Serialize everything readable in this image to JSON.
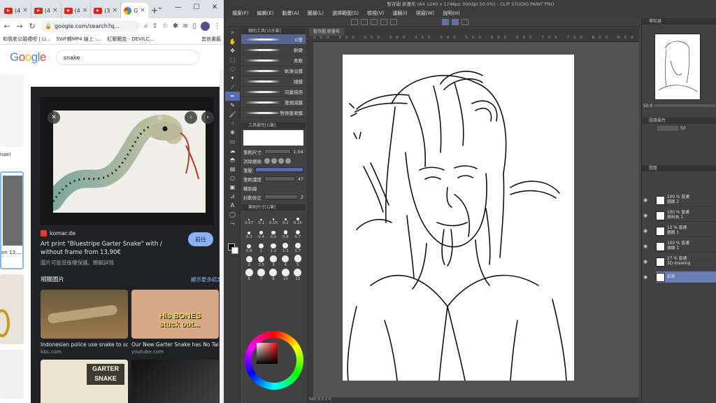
{
  "chrome": {
    "tabs": [
      {
        "label": "(4",
        "icon": "youtube-icon"
      },
      {
        "label": "(4",
        "icon": "youtube-icon"
      },
      {
        "label": "(4",
        "icon": "youtube-icon"
      },
      {
        "label": "(3",
        "icon": "youtube-icon"
      },
      {
        "label": "G",
        "icon": "google-icon",
        "active": true
      }
    ],
    "new_tab": "+",
    "url": "google.com/search?q...",
    "bookmarks": [
      "和我老公婚禮吧 | LI...",
      "SWF轉MP4 線上 -...",
      "紅爾爾克 - DEVILC...",
      "其他書籤"
    ],
    "google_logo": "Google",
    "query": "snake",
    "left_snippets": [
      "nae)",
      "on 13,..."
    ],
    "panel": {
      "source": "komar.de",
      "title": "Art print \"Bluestripe Garter Snake\" with / without frame from 13,90€",
      "visit": "前往",
      "copyright": "圖片可能受版權保護。瞭解詳情",
      "related_heading": "相關圖片",
      "related_more": "顯示更多結果",
      "related": [
        {
          "title": "Indonesian police use snake to scar...",
          "site": "bbc.com"
        },
        {
          "title": "Our New Garter Snake has No Tail! -...",
          "site": "youtube.com",
          "overlay": "His BONES stuck out..."
        },
        {
          "title": "",
          "site": "",
          "overlay": "GARTER SNAKE"
        },
        {
          "title": "",
          "site": ""
        }
      ]
    }
  },
  "csp": {
    "title": "暫存圖 新畫布 (A4 1240 x 1748px 300dpi 50.0%) - CLIP STUDIO PAINT PRO",
    "menu": [
      "檔案(F)",
      "編輯(E)",
      "動畫(A)",
      "圖層(L)",
      "選擇範圍(S)",
      "檢視(V)",
      "濾鏡(I)",
      "視窗(W)",
      "說明(H)"
    ],
    "doc_tabs": [
      "暫存圖 新畫布"
    ],
    "ruler": "250 300 350 400 450 500 550 600 650 700 750 800 850 900 950 1000 1050 1100",
    "sub_tool_title": "輔助工具[沾水筆]",
    "brushes": [
      "G筆",
      "軟硬",
      "柔軟",
      "軟漸淡膜",
      "細膜",
      "向量描用",
      "筆頭減膜",
      "對齊筆漸膜"
    ],
    "tool_prop_title": "工具屬性[G筆]",
    "props": [
      {
        "label": "筆刷尺寸",
        "value": "1.04"
      },
      {
        "label": "消除鋸齒",
        "value": ""
      },
      {
        "label": "筆壓",
        "value": ""
      },
      {
        "label": "筆刷濃度",
        "value": "47"
      },
      {
        "label": "輔助線",
        "value": ""
      },
      {
        "label": "抖動修正",
        "value": "2"
      }
    ],
    "size_title": "筆刷尺寸[G筆]",
    "sizes": [
      "0.07",
      "0.1",
      "0.15",
      "0.2",
      "0.25",
      "0.3",
      "0.4",
      "0.5",
      "0.6",
      "0.7",
      "0.8",
      "1",
      "1.2",
      "1.5",
      "1.7",
      "2",
      "2.5",
      "3",
      "4",
      "5",
      "6",
      "7",
      "8",
      "10",
      "12"
    ],
    "nav_title": "導航器",
    "nav_zoom": "50.0",
    "layer_prop_title": "圖層屬性",
    "layer_blend": "50",
    "layer_title": "圖層",
    "layers": [
      {
        "name": "100 % 普通\n圖層 2",
        "sel": false
      },
      {
        "name": "100 % 普通\n資料夾 1",
        "sel": false
      },
      {
        "name": "13 % 普通\n圖層 1",
        "sel": false
      },
      {
        "name": "100 % 普通\n描線 1",
        "sel": false
      },
      {
        "name": "27 % 普通\n3D drawing",
        "sel": false
      },
      {
        "name": "紙張",
        "sel": true
      }
    ],
    "footer": "500   0.0   2   0"
  },
  "colors": {
    "accent": "#5a6db0",
    "chrome_panel": "#202124",
    "link": "#8ab4f8"
  }
}
